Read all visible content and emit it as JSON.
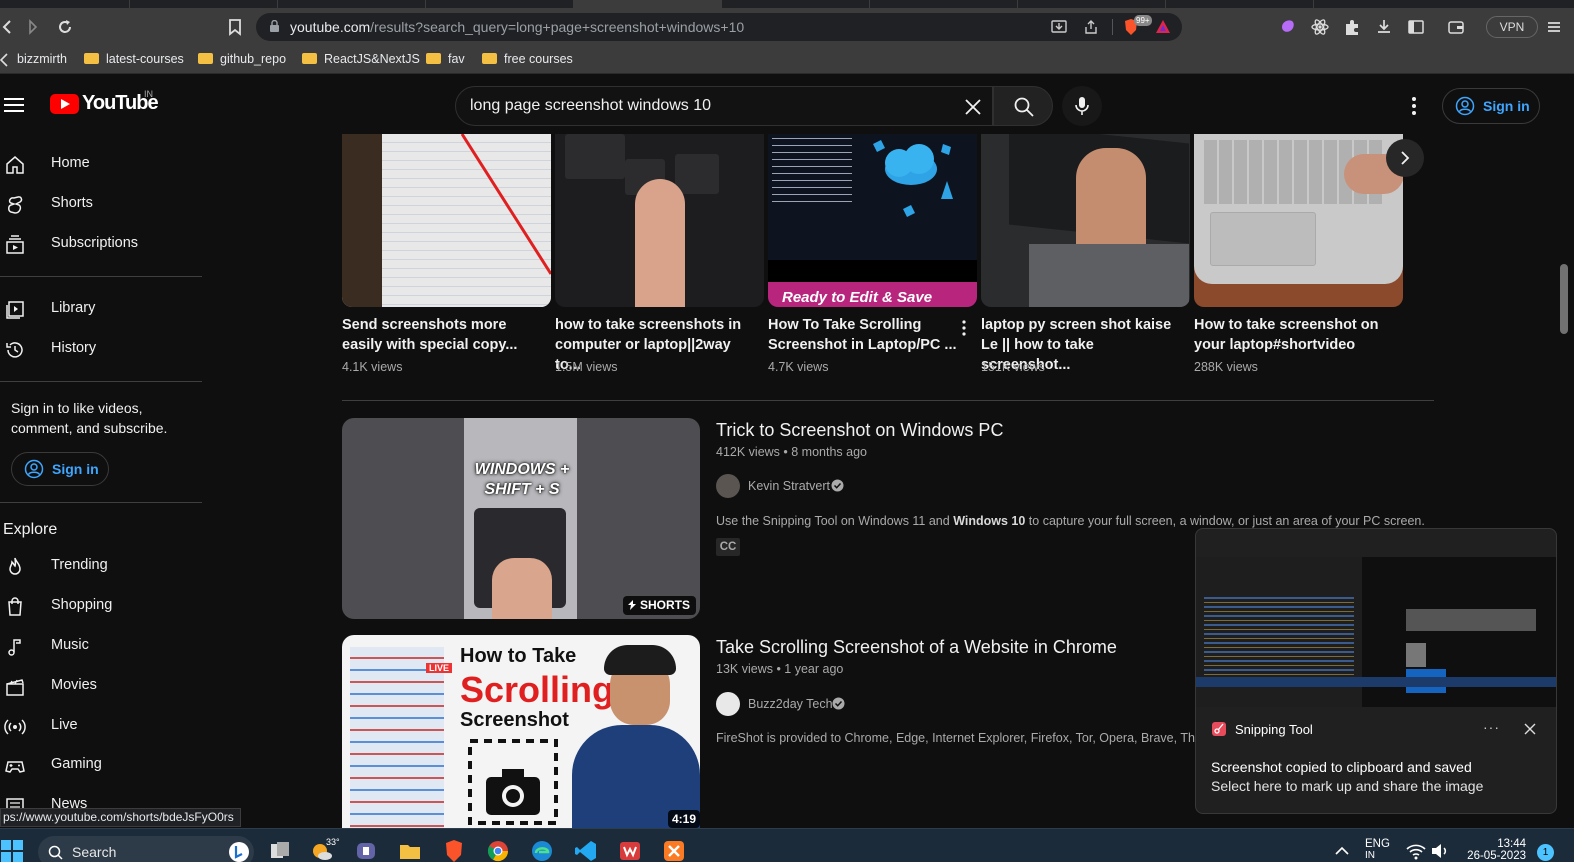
{
  "browser": {
    "url_domain": "youtube.com",
    "url_path": "/results?search_query=long+page+screenshot+windows+10",
    "vpn_label": "VPN",
    "brave_badge": "99+",
    "bookmarks": [
      "bizzmirth",
      "latest-courses",
      "github_repo",
      "ReactJS&NextJS",
      "fav",
      "free courses"
    ]
  },
  "youtube": {
    "logo_text": "YouTube",
    "country_code": "IN",
    "search_query": "long page screenshot windows 10",
    "signin_label": "Sign in"
  },
  "sidebar": {
    "items_top": [
      {
        "label": "Home",
        "icon": "home-icon"
      },
      {
        "label": "Shorts",
        "icon": "shorts-icon"
      },
      {
        "label": "Subscriptions",
        "icon": "subscriptions-icon"
      }
    ],
    "items_mid": [
      {
        "label": "Library",
        "icon": "library-icon"
      },
      {
        "label": "History",
        "icon": "history-icon"
      }
    ],
    "signin_prompt": "Sign in to like videos, comment, and subscribe.",
    "signin_label": "Sign in",
    "explore_heading": "Explore",
    "explore_items": [
      {
        "label": "Trending",
        "icon": "trending-icon"
      },
      {
        "label": "Shopping",
        "icon": "shopping-icon"
      },
      {
        "label": "Music",
        "icon": "music-icon"
      },
      {
        "label": "Movies",
        "icon": "movies-icon"
      },
      {
        "label": "Live",
        "icon": "live-icon"
      },
      {
        "label": "Gaming",
        "icon": "gaming-icon"
      },
      {
        "label": "News",
        "icon": "news-icon"
      }
    ]
  },
  "shorts_shelf": [
    {
      "title": "Send screenshots more\neasily with special copy...",
      "views": "4.1K views",
      "thumb_text": ""
    },
    {
      "title": "how to take screenshots in\ncomputer or laptop||2way to...",
      "views": "1.5M views",
      "thumb_text": ""
    },
    {
      "title": "How To Take Scrolling\nScreenshot in Laptop/PC ...",
      "views": "4.7K views",
      "thumb_text": "Ready to Edit & Save"
    },
    {
      "title": "laptop py screen shot kaise\nLe || how to take screenshot...",
      "views": "151K views",
      "thumb_text": ""
    },
    {
      "title": "How to take screenshot on\nyour laptop#shortvideo",
      "views": "288K views",
      "thumb_text": ""
    }
  ],
  "results": [
    {
      "title": "Trick to Screenshot on Windows PC",
      "meta": "412K views • 8 months ago",
      "channel": "Kevin Stratvert",
      "desc_before": "Use the Snipping Tool on Windows 11 and ",
      "desc_bold": "Windows 10",
      "desc_after": " to capture your full screen, a window, or just an area of your PC screen.",
      "badge": "CC",
      "thumb_line1": "WINDOWS +",
      "thumb_line2": "SHIFT + S",
      "thumb_badge": "SHORTS"
    },
    {
      "title": "Take Scrolling Screenshot of a Website in Chrome",
      "meta": "13K views • 1 year ago",
      "channel": "Buzz2day Tech",
      "desc": "FireShot is provided to Chrome, Edge, Internet Explorer, Firefox, Tor, Opera, Brave, Thunderb",
      "thumb_line1": "How to Take",
      "thumb_line2": "Scrolling",
      "thumb_line3": "Screenshot",
      "thumb_badge": "LIVE",
      "duration": "4:19"
    }
  ],
  "toast": {
    "app_name": "Snipping Tool",
    "more": "···",
    "line1": "Screenshot copied to clipboard and saved",
    "line2": "Select here to mark up and share the image"
  },
  "status_url": "ps://www.youtube.com/shorts/bdeJsFyO0rs",
  "taskbar": {
    "search_label": "Search",
    "weather_temp": "33°",
    "lang": "ENG",
    "lang_sub": "IN",
    "time": "13:44",
    "date": "26-05-2023",
    "notif_count": "1"
  },
  "colors": {
    "background": "#0f0f0f",
    "accent_blue": "#3ea6ff",
    "youtube_red": "#ff0000",
    "chrome_dark": "#3c3c3c"
  }
}
